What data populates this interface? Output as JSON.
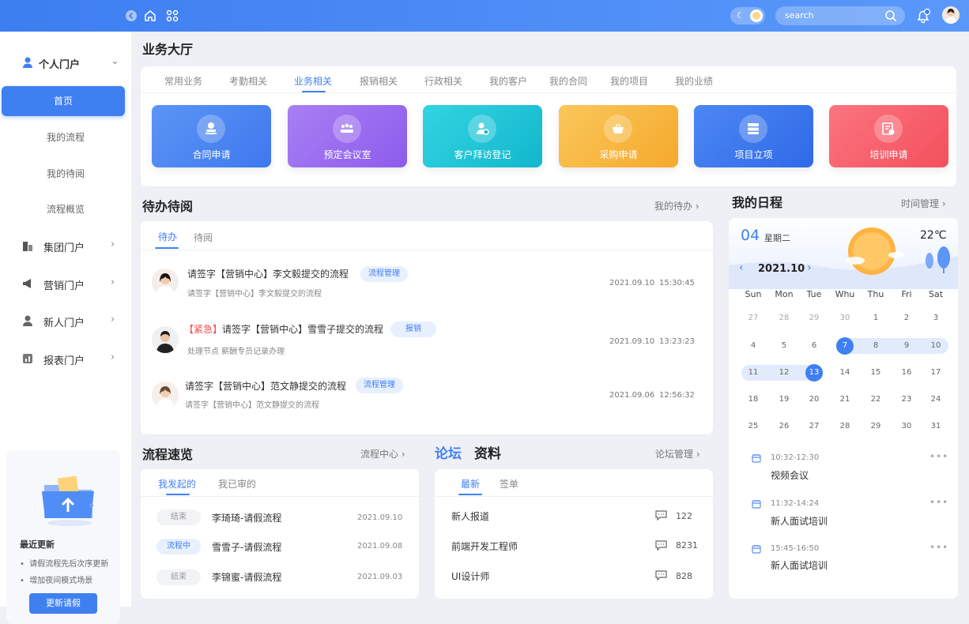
{
  "topbar": {
    "search_placeholder": "search",
    "accent": "#3f80f1"
  },
  "sidebar": {
    "personal_portal": "个人门户",
    "sub_items": [
      "首页",
      "我的流程",
      "我的待阅",
      "流程概览"
    ],
    "groups": [
      "集团门户",
      "营销门户",
      "新人门户",
      "报表门户"
    ],
    "update_card": {
      "title": "最近更新",
      "items": [
        "请假流程先后次序更新",
        "增加夜间模式场景"
      ],
      "button": "更新请假"
    }
  },
  "business_hall": {
    "title": "业务大厅",
    "tabs": [
      "常用业务",
      "考勤相关",
      "业务相关",
      "报销相关",
      "行政相关",
      "我的客户",
      "我的合同",
      "我的项目",
      "我的业绩"
    ],
    "active_tab": "业务相关",
    "cards": [
      {
        "label": "合同申请",
        "color": "#4a86f2",
        "icon": "seal-icon"
      },
      {
        "label": "预定会议室",
        "color": "#9b6cf0",
        "icon": "meeting-icon"
      },
      {
        "label": "客户拜访登记",
        "color": "#1fc4d6",
        "icon": "visitor-icon"
      },
      {
        "label": "采购申请",
        "color": "#f7b63e",
        "icon": "basket-icon"
      },
      {
        "label": "项目立项",
        "color": "#3f78ee",
        "icon": "stack-icon"
      },
      {
        "label": "培训申请",
        "color": "#f75f6b",
        "icon": "training-icon"
      }
    ]
  },
  "todo": {
    "title": "待办待阅",
    "more": "我的待办",
    "tabs": [
      "待办",
      "待阅"
    ],
    "items": [
      {
        "urgent": "",
        "title": "请签字【营销中心】李文毅提交的流程",
        "sub": "请签字【营销中心】李文毅提交的流程",
        "tag": "流程管理",
        "date": "2021.09.10",
        "time": "15:30:45"
      },
      {
        "urgent": "【紧急】",
        "title": "请签字【营销中心】雪雪子提交的流程",
        "sub": "处理节点   薪酬专员记录办理",
        "tag": "报销",
        "date": "2021.09.10",
        "time": "13:23:23"
      },
      {
        "urgent": "",
        "title": "请签字【营销中心】范文静提交的流程",
        "sub": "请签字【营销中心】范文静提交的流程",
        "tag": "流程管理",
        "date": "2021.09.06",
        "time": "12:56:32"
      }
    ]
  },
  "flow": {
    "title": "流程速览",
    "more": "流程中心",
    "tabs": [
      "我发起的",
      "我已审的"
    ],
    "rows": [
      {
        "status": "结束",
        "name": "李琦琦-请假流程",
        "date": "2021.09.10"
      },
      {
        "status": "流程中",
        "name": "雪雪子-请假流程",
        "date": "2021.09.08"
      },
      {
        "status": "结束",
        "name": "李锦蜜-请假流程",
        "date": "2021.09.03"
      }
    ]
  },
  "forum": {
    "title_a": "论坛",
    "title_b": "资料",
    "more": "论坛管理",
    "tabs": [
      "最新",
      "签单"
    ],
    "rows": [
      {
        "name": "新人报道",
        "count": "122"
      },
      {
        "name": "前端开发工程师",
        "count": "8231"
      },
      {
        "name": "UI设计师",
        "count": "828"
      }
    ]
  },
  "schedule": {
    "title": "我的日程",
    "more": "时间管理",
    "day": "04",
    "weekday": "星期二",
    "temp": "22℃",
    "month": "2021.10",
    "weekdays": [
      "Sun",
      "Mon",
      "Tue",
      "Whu",
      "Thu",
      "Fri",
      "Sat"
    ],
    "weeks": [
      [
        "27",
        "28",
        "29",
        "30",
        "1",
        "2",
        "3"
      ],
      [
        "4",
        "5",
        "6",
        "7",
        "8",
        "9",
        "10"
      ],
      [
        "11",
        "12",
        "13",
        "14",
        "15",
        "16",
        "17"
      ],
      [
        "18",
        "19",
        "20",
        "21",
        "22",
        "23",
        "24"
      ],
      [
        "25",
        "26",
        "27",
        "28",
        "29",
        "30",
        "31"
      ]
    ],
    "events": [
      {
        "time": "10:32-12:30",
        "name": "视频会议"
      },
      {
        "time": "11:32-14:24",
        "name": "新人面试培训"
      },
      {
        "time": "15:45-16:50",
        "name": "新人面试培训"
      }
    ]
  }
}
